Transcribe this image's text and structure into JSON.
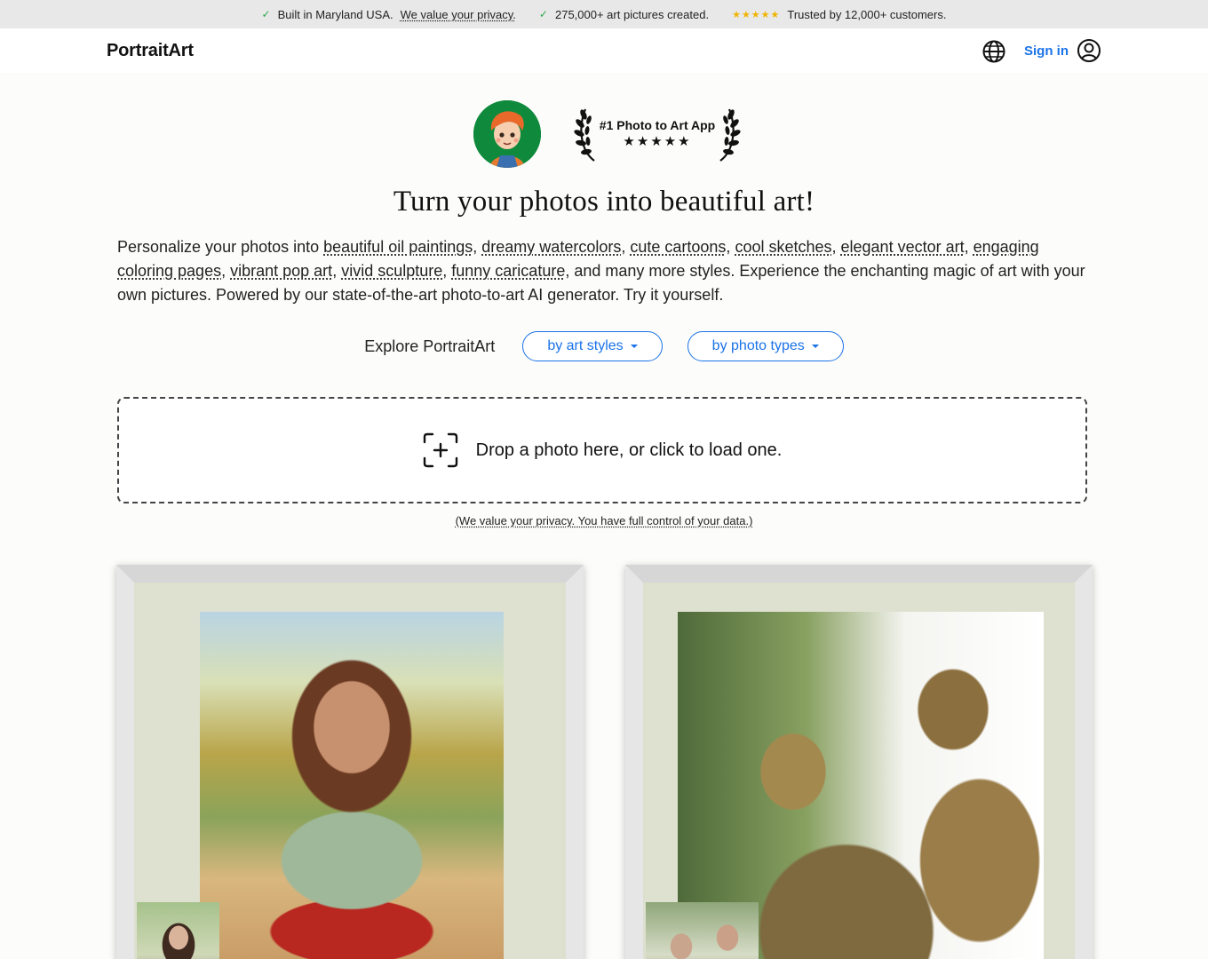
{
  "topbar": {
    "item1_text": "Built in Maryland USA.",
    "item1_link": "We value your privacy.",
    "item2_text": "275,000+ art pictures created.",
    "item3_stars": "★★★★★",
    "item3_text": "Trusted by 12,000+ customers."
  },
  "nav": {
    "logo": "PortraitArt",
    "signin": "Sign in"
  },
  "award": {
    "title": "#1 Photo to Art App",
    "stars": "★★★★★"
  },
  "hero": {
    "title": "Turn your photos into beautiful art!",
    "intro_lead": "Personalize your photos into ",
    "styles": [
      "beautiful oil paintings",
      "dreamy watercolors",
      "cute cartoons",
      "cool sketches",
      "elegant vector art",
      "engaging coloring pages",
      "vibrant pop art",
      "vivid sculpture",
      "funny caricature"
    ],
    "sep": ", ",
    "intro_tail": ", and many more styles. Experience the enchanting magic of art with your own pictures. Powered by our state-of-the-art photo-to-art AI generator. Try it yourself."
  },
  "explore": {
    "label": "Explore PortraitArt",
    "by_styles": "by art styles",
    "by_types": "by photo types"
  },
  "upload": {
    "prompt": "Drop a photo here, or click to load one.",
    "privacy": "(We value your privacy. You have full control of your data.)"
  },
  "colors": {
    "accent": "#1a73e8",
    "check": "#2aa84a",
    "star": "#f0b400"
  }
}
